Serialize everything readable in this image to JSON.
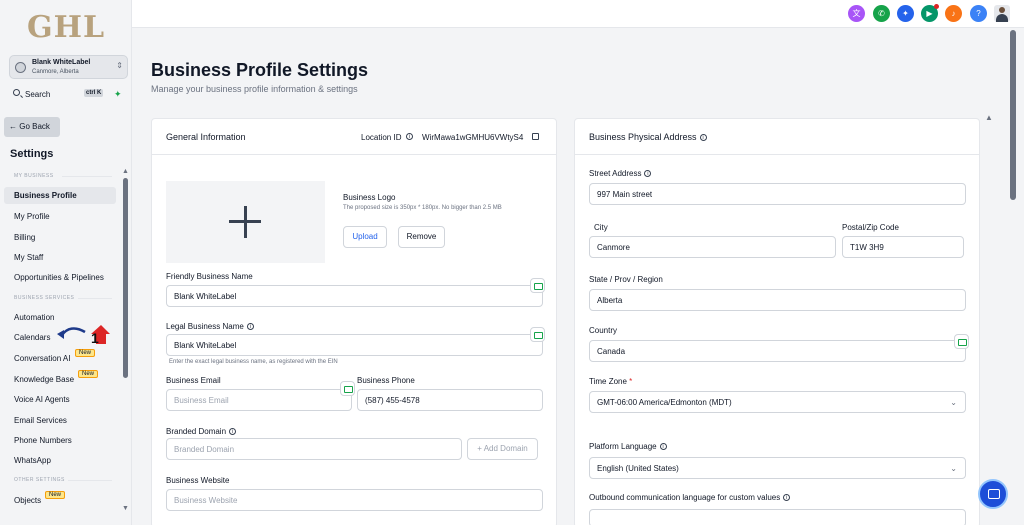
{
  "sidebar": {
    "logo": "GHL",
    "location_name": "Blank WhiteLabel",
    "location_sub": "Canmore, Alberta",
    "search_label": "Search",
    "search_shortcut": "ctrl K",
    "back_label": "← Go Back",
    "settings_title": "Settings",
    "sections": {
      "my_business": "MY BUSINESS",
      "business_services": "BUSINESS SERVICES",
      "other_settings": "OTHER SETTINGS"
    },
    "items": [
      {
        "label": "Business Profile"
      },
      {
        "label": "My Profile"
      },
      {
        "label": "Billing"
      },
      {
        "label": "My Staff"
      },
      {
        "label": "Opportunities & Pipelines"
      },
      {
        "label": "Automation"
      },
      {
        "label": "Calendars"
      },
      {
        "label": "Conversation AI"
      },
      {
        "label": "Knowledge Base"
      },
      {
        "label": "Voice AI Agents"
      },
      {
        "label": "Email Services"
      },
      {
        "label": "Phone Numbers"
      },
      {
        "label": "WhatsApp"
      },
      {
        "label": "Objects"
      }
    ],
    "new_badge": "New",
    "annotation_number": "1"
  },
  "page": {
    "title": "Business Profile Settings",
    "subtitle": "Manage your business profile information & settings"
  },
  "general": {
    "title": "General Information",
    "location_id_label": "Location ID",
    "location_id_value": "WirMawa1wGMHU6VWtyS4",
    "logo_title": "Business Logo",
    "logo_hint": "The proposed size is 350px * 180px. No bigger than 2.5 MB",
    "upload_label": "Upload",
    "remove_label": "Remove",
    "friendly_name_label": "Friendly Business Name",
    "friendly_name_value": "Blank WhiteLabel",
    "legal_name_label": "Legal Business Name",
    "legal_name_value": "Blank WhiteLabel",
    "legal_name_hint": "Enter the exact legal business name, as registered with the EIN",
    "email_label": "Business Email",
    "email_placeholder": "Business Email",
    "phone_label": "Business Phone",
    "phone_value": "(587) 455-4578",
    "domain_label": "Branded Domain",
    "domain_placeholder": "Branded Domain",
    "add_domain_label": "+ Add Domain",
    "website_label": "Business Website",
    "website_placeholder": "Business Website"
  },
  "address": {
    "title": "Business Physical Address",
    "street_label": "Street Address",
    "street_value": "997 Main street",
    "city_label": "City",
    "city_value": "Canmore",
    "zip_label": "Postal/Zip Code",
    "zip_value": "T1W 3H9",
    "state_label": "State / Prov / Region",
    "state_value": "Alberta",
    "country_label": "Country",
    "country_value": "Canada",
    "timezone_label": "Time Zone",
    "timezone_required": "*",
    "timezone_value": "GMT-06:00 America/Edmonton (MDT)",
    "platform_lang_label": "Platform Language",
    "platform_lang_value": "English (United States)",
    "outbound_lang_label": "Outbound communication language for custom values"
  },
  "topbar_icons": [
    {
      "name": "translate-icon",
      "color": "#a855f7",
      "glyph": "文"
    },
    {
      "name": "phone-icon",
      "color": "#16a34a",
      "glyph": "✆"
    },
    {
      "name": "ai-icon",
      "color": "#2563eb",
      "glyph": "✦"
    },
    {
      "name": "megaphone-icon",
      "color": "#059669",
      "glyph": "▶"
    },
    {
      "name": "bell-icon",
      "color": "#f97316",
      "glyph": "♪"
    },
    {
      "name": "help-icon",
      "color": "#3b82f6",
      "glyph": "?"
    }
  ]
}
